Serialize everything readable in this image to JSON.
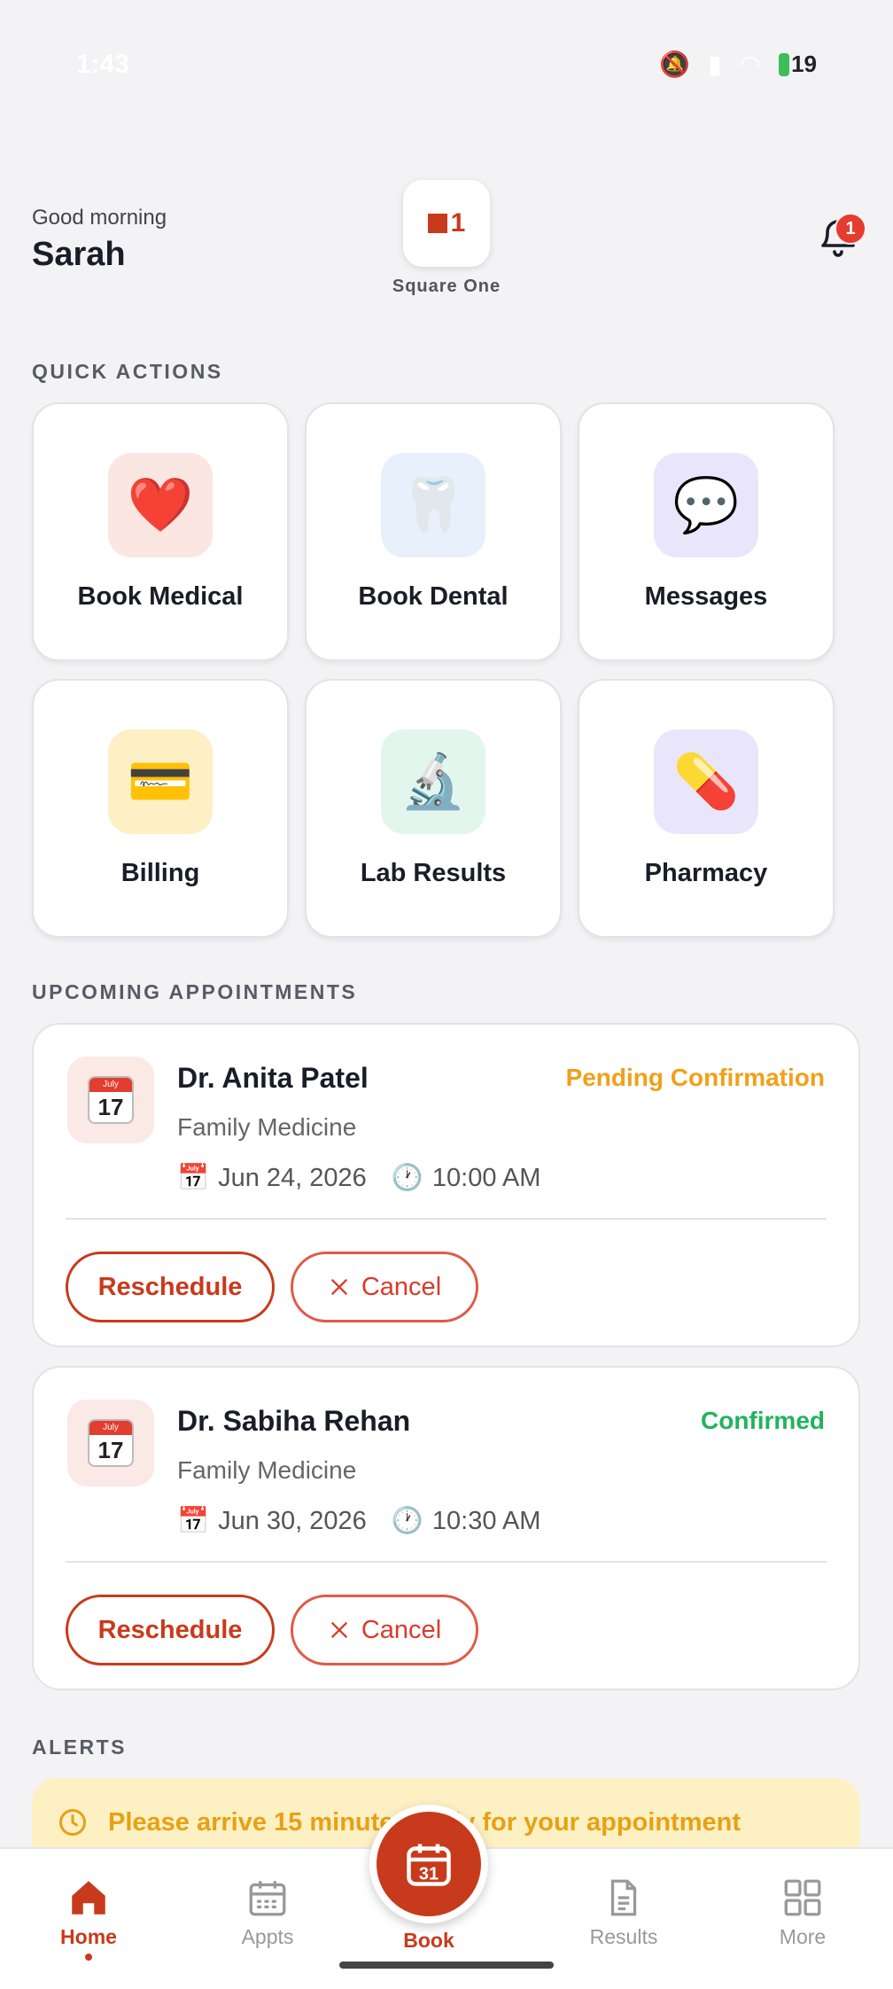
{
  "status_bar": {
    "time": "1:43",
    "battery": "19"
  },
  "header": {
    "greeting": "Good morning",
    "user_name": "Sarah",
    "logo_mark": "1",
    "logo_text": "Square One",
    "notification_count": "1"
  },
  "quick_actions": {
    "title": "QUICK ACTIONS",
    "items": [
      {
        "label": "Book Medical",
        "icon": "heart-icon",
        "glyph": "❤️",
        "bg": "#fbe6e2"
      },
      {
        "label": "Book Dental",
        "icon": "tooth-icon",
        "glyph": "🦷",
        "bg": "#e8f0fb"
      },
      {
        "label": "Messages",
        "icon": "speech-bubble-icon",
        "glyph": "💬",
        "bg": "#e9e6fb"
      },
      {
        "label": "Billing",
        "icon": "credit-card-icon",
        "glyph": "💳",
        "bg": "#fcf0c4"
      },
      {
        "label": "Lab Results",
        "icon": "microscope-icon",
        "glyph": "🔬",
        "bg": "#e3f6ee"
      },
      {
        "label": "Pharmacy",
        "icon": "pill-icon",
        "glyph": "💊",
        "bg": "#e9e6fb"
      }
    ]
  },
  "appointments": {
    "title": "UPCOMING APPOINTMENTS",
    "calendar_month": "July",
    "calendar_day": "17",
    "items": [
      {
        "doctor": "Dr. Anita Patel",
        "specialty": "Family Medicine",
        "status": "Pending Confirmation",
        "status_color": "#f0a01a",
        "date": "Jun 24, 2026",
        "time": "10:00 AM",
        "reschedule_label": "Reschedule",
        "cancel_label": "Cancel"
      },
      {
        "doctor": "Dr. Sabiha Rehan",
        "specialty": "Family Medicine",
        "status": "Confirmed",
        "status_color": "#22b35e",
        "date": "Jun 30, 2026",
        "time": "10:30 AM",
        "reschedule_label": "Reschedule",
        "cancel_label": "Cancel"
      }
    ]
  },
  "alerts": {
    "title": "ALERTS",
    "items": [
      {
        "text": "Please arrive 15 minutes early for your appointment"
      }
    ]
  },
  "nav": {
    "items": [
      {
        "label": "Home",
        "icon": "home-icon",
        "active": true
      },
      {
        "label": "Appts",
        "icon": "calendar-grid-icon",
        "active": false
      },
      {
        "label": "Book",
        "icon": "calendar-31-icon",
        "active": false,
        "fab_day": "31"
      },
      {
        "label": "Results",
        "icon": "document-icon",
        "active": false
      },
      {
        "label": "More",
        "icon": "grid-icon",
        "active": false
      }
    ]
  },
  "colors": {
    "brand": "#c83a1c",
    "background": "#f3f3f6",
    "pending": "#f0a01a",
    "confirmed": "#22b35e"
  }
}
